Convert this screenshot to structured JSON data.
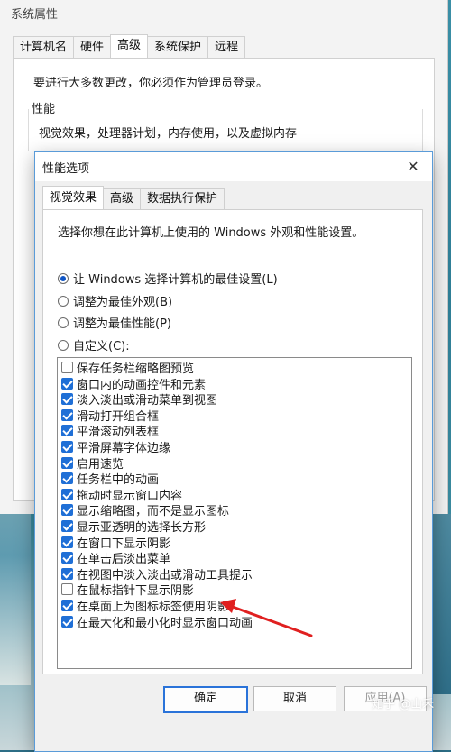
{
  "sys_window": {
    "title": "系统属性",
    "tabs": [
      "计算机名",
      "硬件",
      "高级",
      "系统保护",
      "远程"
    ],
    "admin_note": "要进行大多数更改，你必须作为管理员登录。",
    "performance_group": {
      "title": "性能",
      "description": "视觉效果，处理器计划，内存使用，以及虚拟内存"
    }
  },
  "dialog": {
    "title": "性能选项",
    "tabs": [
      "视觉效果",
      "高级",
      "数据执行保护"
    ],
    "intro": "选择你想在此计算机上使用的 Windows 外观和性能设置。",
    "radios": [
      {
        "label": "让 Windows 选择计算机的最佳设置(L)",
        "selected": true
      },
      {
        "label": "调整为最佳外观(B)",
        "selected": false
      },
      {
        "label": "调整为最佳性能(P)",
        "selected": false
      },
      {
        "label": "自定义(C):",
        "selected": false
      }
    ],
    "options": [
      {
        "label": "保存任务栏缩略图预览",
        "checked": false
      },
      {
        "label": "窗口内的动画控件和元素",
        "checked": true
      },
      {
        "label": "淡入淡出或滑动菜单到视图",
        "checked": true
      },
      {
        "label": "滑动打开组合框",
        "checked": true
      },
      {
        "label": "平滑滚动列表框",
        "checked": true
      },
      {
        "label": "平滑屏幕字体边缘",
        "checked": true
      },
      {
        "label": "启用速览",
        "checked": true
      },
      {
        "label": "任务栏中的动画",
        "checked": true
      },
      {
        "label": "拖动时显示窗口内容",
        "checked": true
      },
      {
        "label": "显示缩略图，而不是显示图标",
        "checked": true
      },
      {
        "label": "显示亚透明的选择长方形",
        "checked": true
      },
      {
        "label": "在窗口下显示阴影",
        "checked": true
      },
      {
        "label": "在单击后淡出菜单",
        "checked": true
      },
      {
        "label": "在视图中淡入淡出或滑动工具提示",
        "checked": true
      },
      {
        "label": "在鼠标指针下显示阴影",
        "checked": false
      },
      {
        "label": "在桌面上为图标标签使用阴影",
        "checked": true
      },
      {
        "label": "在最大化和最小化时显示窗口动画",
        "checked": true
      }
    ],
    "buttons": {
      "ok": "确定",
      "cancel": "取消",
      "apply": "应用(A)"
    },
    "close_icon": "close-icon"
  },
  "colors": {
    "accent": "#1f6fd6",
    "annotation_arrow": "#e02020"
  },
  "watermark": "知乎 @山禾"
}
